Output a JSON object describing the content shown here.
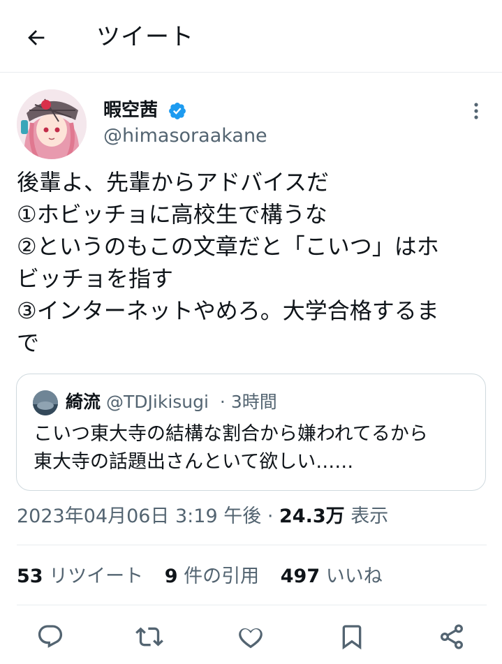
{
  "header": {
    "title": "ツイート"
  },
  "author": {
    "name": "暇空茜",
    "handle": "@himasoraakane",
    "verified": true
  },
  "tweet": {
    "lines": [
      "後輩よ、先輩からアドバイスだ",
      "①ホビッチョに高校生で構うな",
      "②というのもこの文章だと「こいつ」はホ",
      "ビッチョを指す",
      "③インターネットやめろ。大学合格するま",
      "で"
    ]
  },
  "quote": {
    "name": "綺流",
    "handle": "@TDJikisugi",
    "time": "· 3時間",
    "lines": [
      "こいつ東大寺の結構な割合から嫌われてるから",
      "東大寺の話題出さんといて欲しい……"
    ]
  },
  "meta": {
    "timestamp": "2023年04月06日 3:19 午後",
    "separator": "·",
    "views": "24.3万",
    "views_label": "表示"
  },
  "stats": {
    "retweets": "53",
    "retweets_label": "リツイート",
    "quotes": "9",
    "quotes_label": "件の引用",
    "likes": "497",
    "likes_label": "いいね"
  },
  "colors": {
    "accent": "#1d9bf0",
    "text": "#0f1419",
    "secondary": "#536471",
    "border": "#cfd9de"
  },
  "icons": [
    "back-arrow-icon",
    "verified-badge-icon",
    "more-vertical-icon",
    "reply-icon",
    "retweet-icon",
    "like-icon",
    "bookmark-icon",
    "share-icon"
  ]
}
